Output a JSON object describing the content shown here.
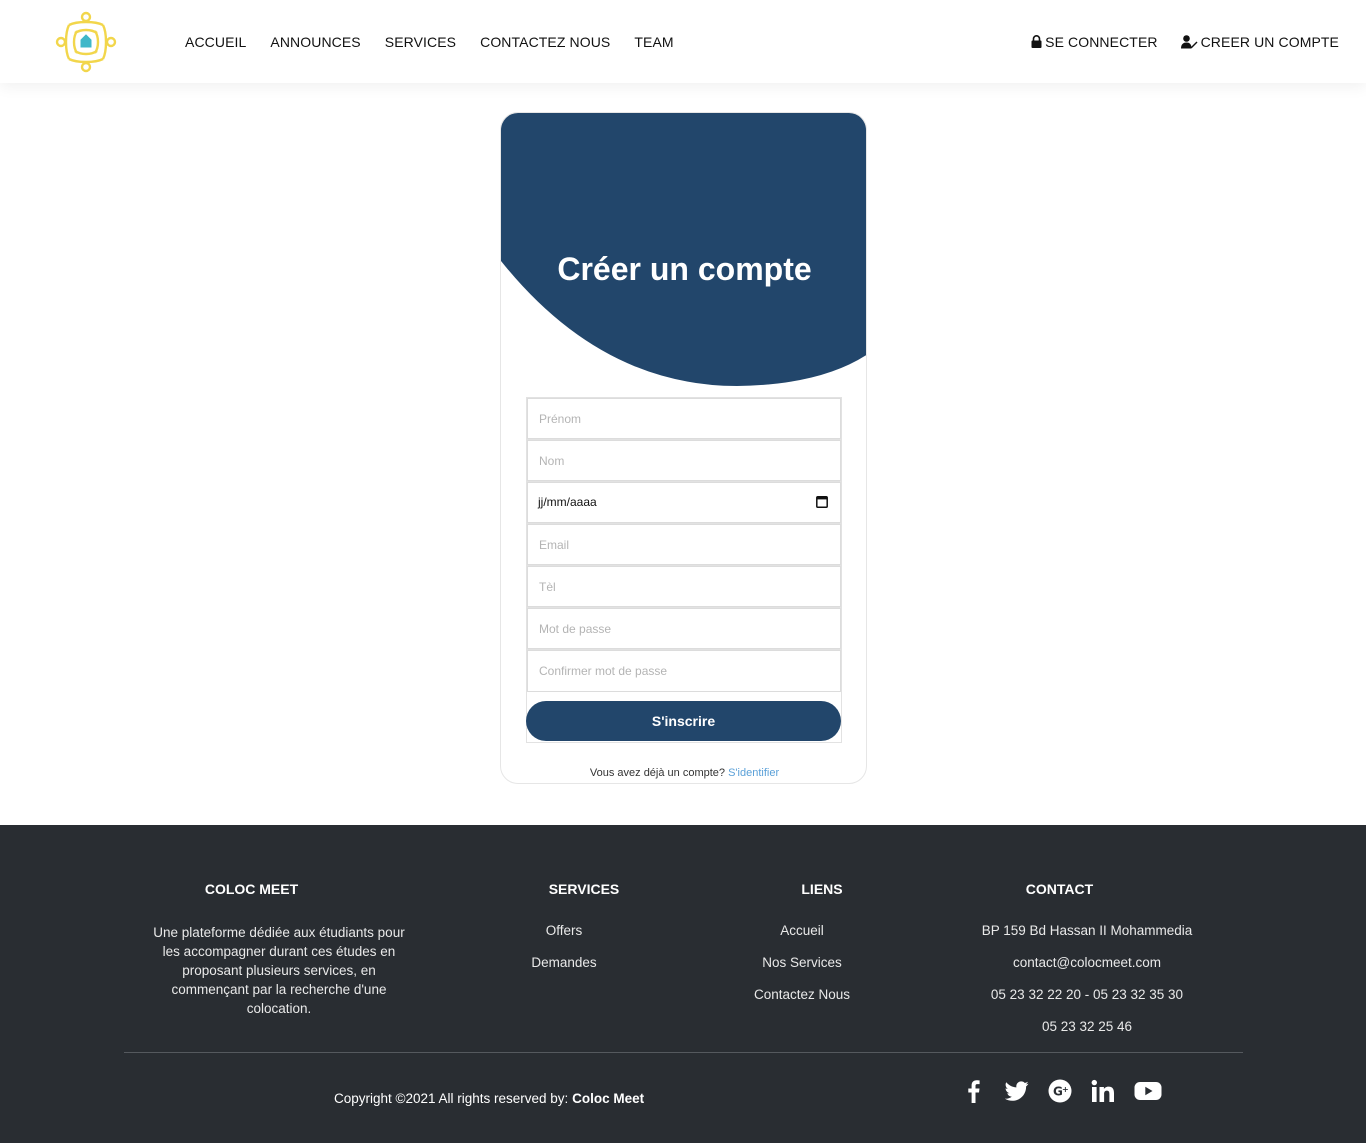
{
  "nav": {
    "items": [
      {
        "label": "ACCUEIL"
      },
      {
        "label": "ANNOUNCES"
      },
      {
        "label": "SERVICES"
      },
      {
        "label": "CONTACTEZ NOUS"
      },
      {
        "label": "TEAM"
      }
    ],
    "login_label": "SE CONNECTER",
    "signup_label": "CREER UN COMPTE",
    "login_icon": "lock-icon",
    "signup_icon": "user-edit-icon"
  },
  "card": {
    "title": "Créer un compte",
    "fields": {
      "prenom": {
        "placeholder": "Prénom"
      },
      "nom": {
        "placeholder": "Nom"
      },
      "date": {
        "value": "jj/mm/aaaa"
      },
      "email": {
        "placeholder": "Email"
      },
      "tel": {
        "placeholder": "Tèl"
      },
      "password": {
        "placeholder": "Mot de passe"
      },
      "confirm": {
        "placeholder": "Confirmer mot de passe"
      }
    },
    "submit_label": "S'inscrire",
    "login_prompt": "Vous avez déjà un compte?",
    "login_link": "S'identifier"
  },
  "footer": {
    "about": {
      "title": "COLOC MEET",
      "text": "Une plateforme dédiée aux étudiants pour les accompagner durant ces études en proposant plusieurs services, en commençant par la recherche d'une colocation."
    },
    "services": {
      "title": "SERVICES",
      "items": [
        "Offers",
        "Demandes"
      ]
    },
    "liens": {
      "title": "LIENS",
      "items": [
        "Accueil",
        "Nos Services",
        "Contactez Nous"
      ]
    },
    "contact": {
      "title": "CONTACT",
      "items": [
        "BP 159 Bd Hassan II Mohammedia",
        "contact@colocmeet.com",
        "05 23 32 22 20 - 05 23 32 35 30",
        "05 23 32 25 46"
      ]
    },
    "copyright_prefix": "Copyright ©2021 All rights reserved by:",
    "copyright_brand": "Coloc Meet",
    "socials": [
      "facebook-icon",
      "twitter-icon",
      "google-plus-icon",
      "linkedin-icon",
      "youtube-icon"
    ]
  },
  "colors": {
    "primary": "#22466b",
    "footer_bg": "#292d32",
    "logo": "#f2d64b",
    "link": "#5aa0d8"
  }
}
